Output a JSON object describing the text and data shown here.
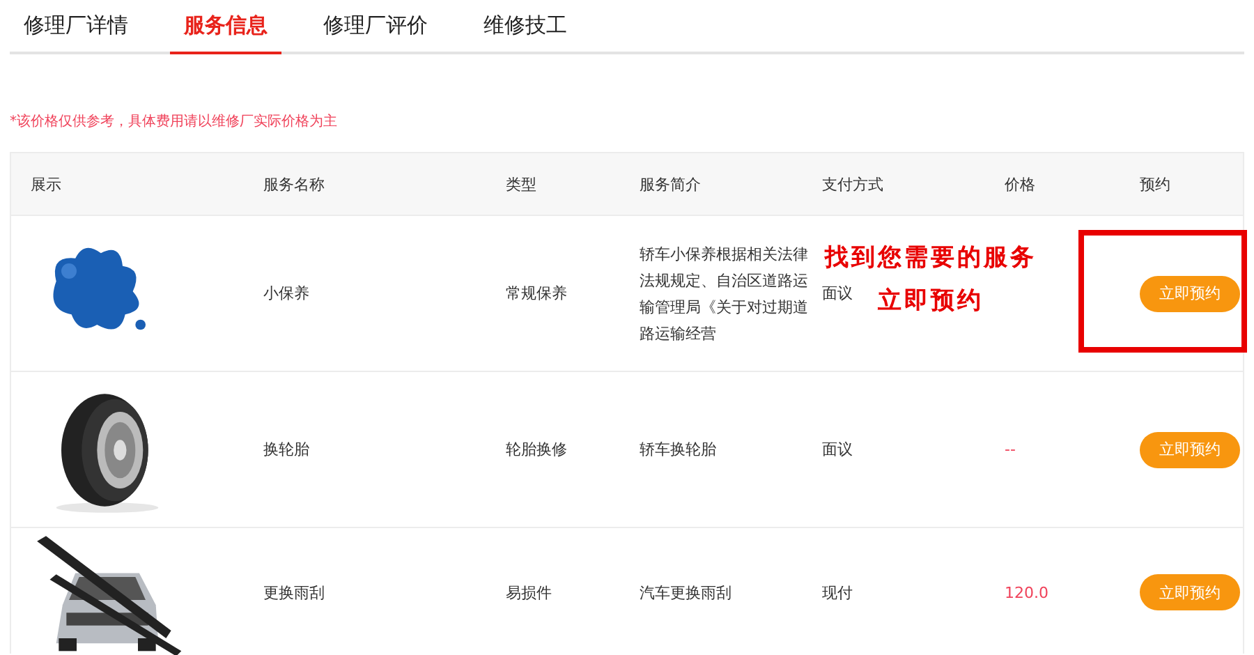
{
  "tabs": [
    {
      "label": "修理厂详情",
      "selected": false
    },
    {
      "label": "服务信息",
      "selected": true
    },
    {
      "label": "修理厂评价",
      "selected": false
    },
    {
      "label": "维修技工",
      "selected": false
    }
  ],
  "notice": "*该价格仅供参考，具体费用请以维修厂实际价格为主",
  "table": {
    "columns": [
      "展示",
      "服务名称",
      "类型",
      "服务简介",
      "支付方式",
      "价格",
      "预约"
    ],
    "rows": [
      {
        "name": "小保养",
        "type": "常规保养",
        "description": "轿车小保养根据相关法律法规规定、自治区道路运输管理局《关于对过期道路运输经营",
        "payment": "面议",
        "button": "立即预约"
      },
      {
        "name": "换轮胎",
        "type": "轮胎换修",
        "description": "轿车换轮胎",
        "payment": "面议",
        "price": "--",
        "button": "立即预约"
      },
      {
        "name": "更换雨刮",
        "type": "易损件",
        "description": "汽车更换雨刮",
        "payment": "现付",
        "price": "120.0",
        "button": "立即预约"
      }
    ]
  },
  "annotation": {
    "lines": [
      "找到您需要的服务",
      "立即预约"
    ]
  }
}
